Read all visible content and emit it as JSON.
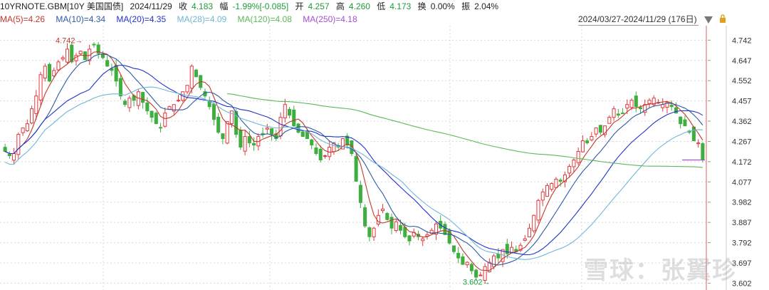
{
  "header": {
    "symbol": "10YRNOTE.GBM[10Y 美国国债]",
    "date": "2024/11/29",
    "close_label": "收",
    "close_value": "4.183",
    "change_label": "幅",
    "change_value": "-1.99%[-0.085]",
    "open_label": "开",
    "open_value": "4.257",
    "high_label": "高",
    "high_value": "4.260",
    "low_label": "低",
    "low_value": "4.173",
    "turnover_label": "换",
    "turnover_value": "0.00%",
    "amplitude_label": "振",
    "amplitude_value": "2.04%"
  },
  "ma_legend": [
    {
      "label": "MA(5)=4.26",
      "color": "#c0392b"
    },
    {
      "label": "MA(10)=4.34",
      "color": "#2e5aa8"
    },
    {
      "label": "MA(20)=4.35",
      "color": "#2233cc"
    },
    {
      "label": "MA(28)=4.09",
      "color": "#6fb7d6"
    },
    {
      "label": "MA(120)=4.08",
      "color": "#5cb85c"
    },
    {
      "label": "MA(250)=4.18",
      "color": "#a64dd6"
    }
  ],
  "range_text": "2024/03/27-2024/11/29 (176日)",
  "watermark": "雪球：张翼珍",
  "chart_data": {
    "type": "candlestick",
    "x_range": [
      "2024/03/27",
      "2024/11/29"
    ],
    "trading_days": 176,
    "yticks": [
      4.742,
      4.647,
      4.552,
      4.457,
      4.362,
      4.267,
      4.172,
      4.077,
      3.982,
      3.887,
      3.792,
      3.697,
      3.602
    ],
    "ylim": [
      3.58,
      4.8
    ],
    "annotations": [
      {
        "text": "4.742",
        "value": 4.742,
        "kind": "max"
      },
      {
        "text": "3.602",
        "value": 3.602,
        "kind": "min"
      }
    ],
    "close_path": [
      4.22,
      4.2,
      4.21,
      4.3,
      4.33,
      4.35,
      4.42,
      4.48,
      4.58,
      4.62,
      4.55,
      4.6,
      4.64,
      4.66,
      4.7,
      4.64,
      4.67,
      4.69,
      4.65,
      4.7,
      4.72,
      4.68,
      4.66,
      4.62,
      4.6,
      4.55,
      4.48,
      4.44,
      4.47,
      4.46,
      4.5,
      4.45,
      4.41,
      4.38,
      4.35,
      4.33,
      4.4,
      4.43,
      4.44,
      4.46,
      4.5,
      4.53,
      4.62,
      4.57,
      4.52,
      4.48,
      4.43,
      4.37,
      4.31,
      4.28,
      4.36,
      4.41,
      4.3,
      4.24,
      4.29,
      4.26,
      4.25,
      4.29,
      4.3,
      4.33,
      4.3,
      4.28,
      4.38,
      4.44,
      4.39,
      4.34,
      4.31,
      4.29,
      4.28,
      4.25,
      4.21,
      4.18,
      4.2,
      4.24,
      4.26,
      4.24,
      4.28,
      4.25,
      4.21,
      4.08,
      3.98,
      3.87,
      3.82,
      3.86,
      3.92,
      3.95,
      3.9,
      3.86,
      3.89,
      3.85,
      3.82,
      3.8,
      3.84,
      3.82,
      3.81,
      3.83,
      3.85,
      3.88,
      3.86,
      3.83,
      3.79,
      3.75,
      3.72,
      3.69,
      3.7,
      3.66,
      3.63,
      3.64,
      3.68,
      3.7,
      3.73,
      3.72,
      3.76,
      3.74,
      3.77,
      3.75,
      3.78,
      3.81,
      3.86,
      3.92,
      3.99,
      4.03,
      4.06,
      4.07,
      4.09,
      4.08,
      4.11,
      4.15,
      4.18,
      4.22,
      4.27,
      4.26,
      4.29,
      4.33,
      4.31,
      4.34,
      4.38,
      4.42,
      4.39,
      4.4,
      4.44,
      4.46,
      4.43,
      4.42,
      4.44,
      4.46,
      4.47,
      4.45,
      4.44,
      4.45,
      4.43,
      4.4,
      4.35,
      4.34,
      4.31,
      4.27,
      4.26,
      4.183
    ],
    "series": [
      {
        "name": "MA(5)",
        "color": "#c0392b"
      },
      {
        "name": "MA(10)",
        "color": "#2e5aa8"
      },
      {
        "name": "MA(20)",
        "color": "#2233cc"
      },
      {
        "name": "MA(28)",
        "color": "#6fb7d6"
      },
      {
        "name": "MA(120)",
        "color": "#5cb85c"
      },
      {
        "name": "MA(250)",
        "color": "#a64dd6"
      }
    ],
    "up_color": "#e0393e",
    "down_color": "#3fae3f",
    "grid": true
  }
}
